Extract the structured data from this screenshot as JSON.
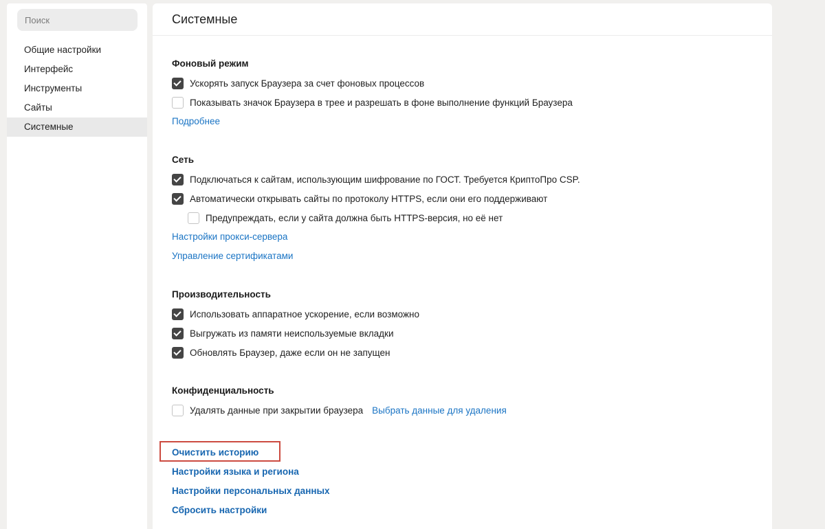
{
  "sidebar": {
    "search_placeholder": "Поиск",
    "items": [
      {
        "label": "Общие настройки"
      },
      {
        "label": "Интерфейс"
      },
      {
        "label": "Инструменты"
      },
      {
        "label": "Сайты"
      },
      {
        "label": "Системные",
        "active": true
      }
    ]
  },
  "main": {
    "title": "Системные",
    "background": {
      "title": "Фоновый режим",
      "opt1": {
        "label": "Ускорять запуск Браузера за счет фоновых процессов",
        "checked": true
      },
      "opt2": {
        "label": "Показывать значок Браузера в трее и разрешать в фоне выполнение функций Браузера",
        "checked": false
      },
      "more_link": "Подробнее"
    },
    "network": {
      "title": "Сеть",
      "opt1": {
        "label": "Подключаться к сайтам, использующим шифрование по ГОСТ. Требуется КриптоПро CSP.",
        "checked": true
      },
      "opt2": {
        "label": "Автоматически открывать сайты по протоколу HTTPS, если они его поддерживают",
        "checked": true
      },
      "opt3": {
        "label": "Предупреждать, если у сайта должна быть HTTPS-версия, но её нет",
        "checked": false
      },
      "proxy_link": "Настройки прокси-сервера",
      "certs_link": "Управление сертификатами"
    },
    "performance": {
      "title": "Производительность",
      "opt1": {
        "label": "Использовать аппаратное ускорение, если возможно",
        "checked": true
      },
      "opt2": {
        "label": "Выгружать из памяти неиспользуемые вкладки",
        "checked": true
      },
      "opt3": {
        "label": "Обновлять Браузер, даже если он не запущен",
        "checked": true
      }
    },
    "privacy": {
      "title": "Конфиденциальность",
      "opt1": {
        "label": "Удалять данные при закрытии браузера",
        "checked": false
      },
      "choose_link": "Выбрать данные для удаления"
    },
    "actions": {
      "clear_history": "Очистить историю",
      "language": "Настройки языка и региона",
      "personal": "Настройки персональных данных",
      "reset": "Сбросить настройки"
    }
  },
  "colors": {
    "link": "#1a74c4",
    "checkbox_checked": "#454545",
    "highlight": "#cc4a3f"
  }
}
